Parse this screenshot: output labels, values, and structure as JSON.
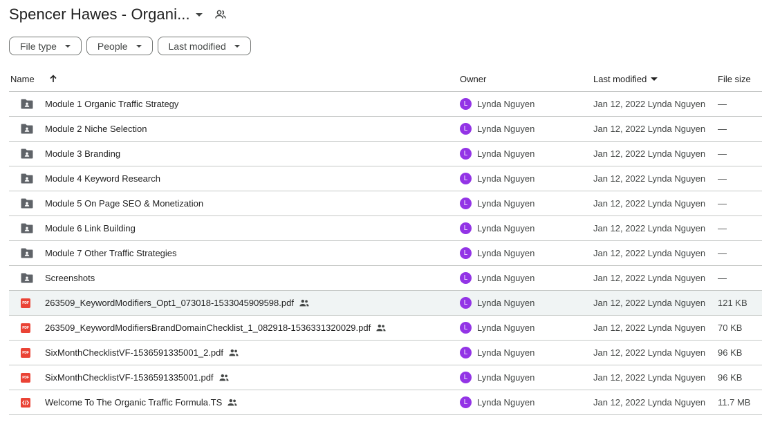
{
  "header": {
    "title": "Spencer Hawes - Organi..."
  },
  "filters": [
    {
      "label": "File type"
    },
    {
      "label": "People"
    },
    {
      "label": "Last modified"
    }
  ],
  "columns": {
    "name": "Name",
    "owner": "Owner",
    "last_modified": "Last modified",
    "file_size": "File size"
  },
  "files": [
    {
      "type": "folder",
      "name": "Module 1 Organic Traffic Strategy",
      "shared": false,
      "owner_initial": "L",
      "owner": "Lynda Nguyen",
      "modified": "Jan 12, 2022 Lynda Nguyen",
      "size": "—"
    },
    {
      "type": "folder",
      "name": "Module 2 Niche Selection",
      "shared": false,
      "owner_initial": "L",
      "owner": "Lynda Nguyen",
      "modified": "Jan 12, 2022 Lynda Nguyen",
      "size": "—"
    },
    {
      "type": "folder",
      "name": "Module 3 Branding",
      "shared": false,
      "owner_initial": "L",
      "owner": "Lynda Nguyen",
      "modified": "Jan 12, 2022 Lynda Nguyen",
      "size": "—"
    },
    {
      "type": "folder",
      "name": "Module 4 Keyword Research",
      "shared": false,
      "owner_initial": "L",
      "owner": "Lynda Nguyen",
      "modified": "Jan 12, 2022 Lynda Nguyen",
      "size": "—"
    },
    {
      "type": "folder",
      "name": "Module 5 On Page SEO & Monetization",
      "shared": false,
      "owner_initial": "L",
      "owner": "Lynda Nguyen",
      "modified": "Jan 12, 2022 Lynda Nguyen",
      "size": "—"
    },
    {
      "type": "folder",
      "name": "Module 6 Link Building",
      "shared": false,
      "owner_initial": "L",
      "owner": "Lynda Nguyen",
      "modified": "Jan 12, 2022 Lynda Nguyen",
      "size": "—"
    },
    {
      "type": "folder",
      "name": "Module 7 Other Traffic Strategies",
      "shared": false,
      "owner_initial": "L",
      "owner": "Lynda Nguyen",
      "modified": "Jan 12, 2022 Lynda Nguyen",
      "size": "—"
    },
    {
      "type": "folder",
      "name": "Screenshots",
      "shared": false,
      "owner_initial": "L",
      "owner": "Lynda Nguyen",
      "modified": "Jan 12, 2022 Lynda Nguyen",
      "size": "—"
    },
    {
      "type": "pdf",
      "name": "263509_KeywordModifiers_Opt1_073018-1533045909598.pdf",
      "shared": true,
      "highlighted": true,
      "owner_initial": "L",
      "owner": "Lynda Nguyen",
      "modified": "Jan 12, 2022 Lynda Nguyen",
      "size": "121 KB"
    },
    {
      "type": "pdf",
      "name": "263509_KeywordModifiersBrandDomainChecklist_1_082918-1536331320029.pdf",
      "shared": true,
      "owner_initial": "L",
      "owner": "Lynda Nguyen",
      "modified": "Jan 12, 2022 Lynda Nguyen",
      "size": "70 KB"
    },
    {
      "type": "pdf",
      "name": "SixMonthChecklistVF-1536591335001_2.pdf",
      "shared": true,
      "owner_initial": "L",
      "owner": "Lynda Nguyen",
      "modified": "Jan 12, 2022 Lynda Nguyen",
      "size": "96 KB"
    },
    {
      "type": "pdf",
      "name": "SixMonthChecklistVF-1536591335001.pdf",
      "shared": true,
      "owner_initial": "L",
      "owner": "Lynda Nguyen",
      "modified": "Jan 12, 2022 Lynda Nguyen",
      "size": "96 KB"
    },
    {
      "type": "code",
      "name": "Welcome To The Organic Traffic Formula.TS",
      "shared": true,
      "owner_initial": "L",
      "owner": "Lynda Nguyen",
      "modified": "Jan 12, 2022 Lynda Nguyen",
      "size": "11.7 MB"
    }
  ],
  "colors": {
    "avatar": "#9334e6",
    "file_red": "#ea4335",
    "divider": "#c4c7c5",
    "highlight_row": "#f0f4f4"
  },
  "icons": {
    "folder": "shared-folder-icon",
    "pdf": "pdf-icon",
    "code": "code-file-icon",
    "shared": "people-icon",
    "sort": "arrow-up-icon"
  }
}
